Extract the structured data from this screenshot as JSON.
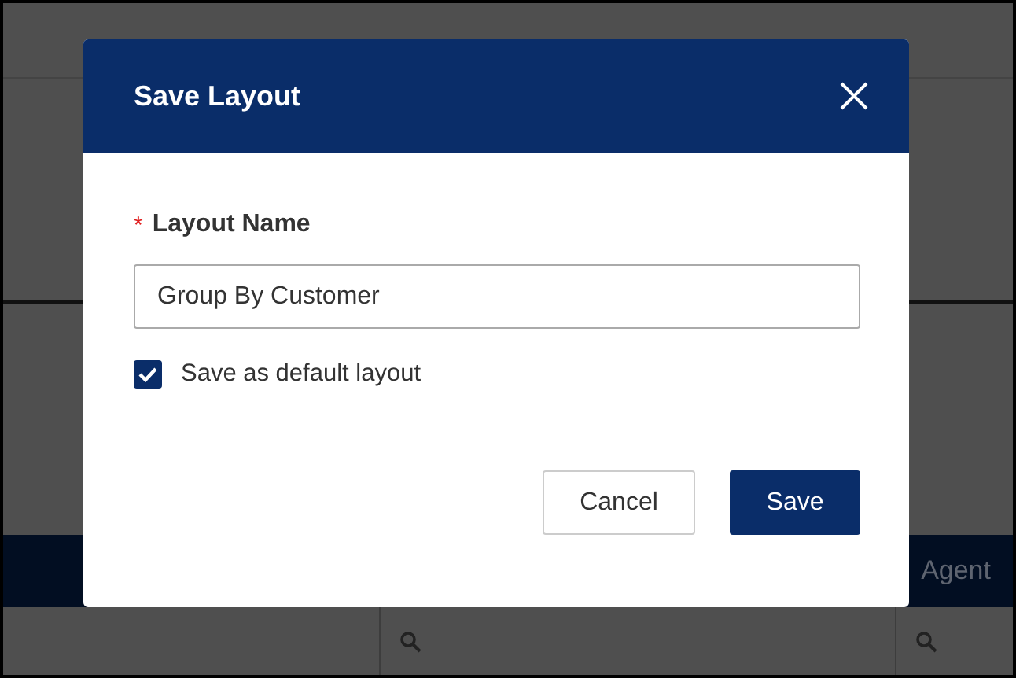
{
  "background": {
    "header_label": "Agent",
    "filter_cells": [
      {
        "search": false
      },
      {
        "search": true
      },
      {
        "search": true
      }
    ]
  },
  "dialog": {
    "title": "Save Layout",
    "field": {
      "required_mark": "*",
      "label": "Layout Name",
      "value": "Group By Customer"
    },
    "checkbox": {
      "label": "Save as default layout",
      "checked": true
    },
    "buttons": [
      {
        "label": "Cancel",
        "kind": "secondary"
      },
      {
        "label": "Save",
        "kind": "primary"
      }
    ]
  }
}
